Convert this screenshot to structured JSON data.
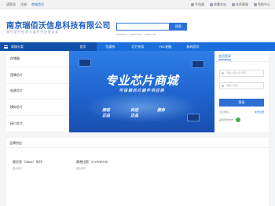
{
  "topbar": {
    "left": [
      "请登录",
      "注册",
      "商城首页"
    ],
    "right": [
      "手机端",
      "收藏本站",
      "在线客服",
      "帮助中心"
    ]
  },
  "header": {
    "company": "南京瑞佰沃信息科技有限公司",
    "subtitle": "我们是专业的元器件供应服务商",
    "search_placeholder": "",
    "search_button": "搜索",
    "hot_keywords": "EN80C607 · 6a54737F2 · LT2RPOM3"
  },
  "nav": {
    "category": "商城分类",
    "items": [
      "首页",
      "优惠券",
      "芯片热卖",
      "PBC制板",
      "新闻资讯"
    ]
  },
  "sidebar": {
    "items": [
      "存储器",
      "逻辑芯片",
      "电源芯片",
      "模拟芯片",
      "接口芯片"
    ]
  },
  "banner": {
    "title": "专业芯片商城",
    "slogan": "可信赖的元器件供应商",
    "tags": [
      "原装\n正品",
      "优选\n正品",
      "服务"
    ]
  },
  "login": {
    "title": "会员登录",
    "username_placeholder": "请输入用户名/手机",
    "password_placeholder": "请输入密码",
    "login_button": "登录",
    "forgot": "忘记密码",
    "register": "免费注册",
    "other_login": "其他登录方式"
  },
  "brands": {
    "title": "品牌供应",
    "cards": [
      {
        "name": "赛灵思（Xilinx）系列",
        "more": "更多型号"
      },
      {
        "name": "赛普拉斯（CYPRESS）",
        "more": "更多型号"
      }
    ]
  }
}
